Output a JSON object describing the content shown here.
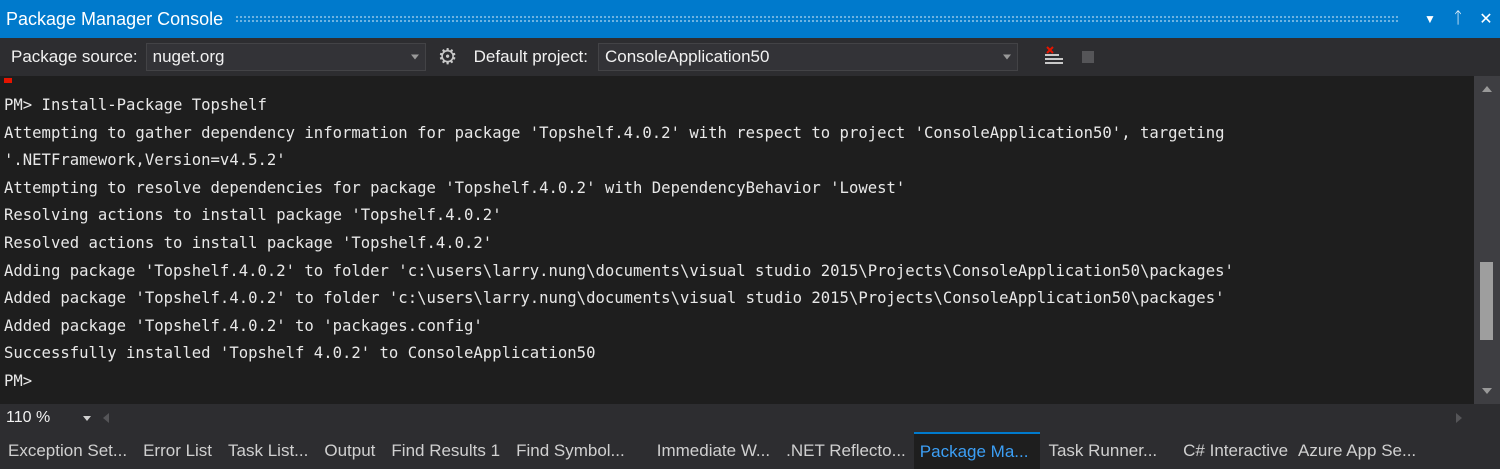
{
  "window": {
    "title": "Package Manager Console",
    "dropdown_glyph": "▼",
    "pin_glyph": "ᛏ",
    "close_glyph": "✕"
  },
  "toolbar": {
    "package_source_label": "Package source:",
    "package_source_value": "nuget.org",
    "default_project_label": "Default project:",
    "default_project_value": "ConsoleApplication50",
    "settings_icon": "gear-icon",
    "clear_icon": "clear-console-icon",
    "stop_icon": "stop-icon"
  },
  "console": {
    "lines": [
      "PM> Install-Package Topshelf",
      "Attempting to gather dependency information for package 'Topshelf.4.0.2' with respect to project 'ConsoleApplication50', targeting",
      "'.NETFramework,Version=v4.5.2'",
      "Attempting to resolve dependencies for package 'Topshelf.4.0.2' with DependencyBehavior 'Lowest'",
      "Resolving actions to install package 'Topshelf.4.0.2'",
      "Resolved actions to install package 'Topshelf.4.0.2'",
      "Adding package 'Topshelf.4.0.2' to folder 'c:\\users\\larry.nung\\documents\\visual studio 2015\\Projects\\ConsoleApplication50\\packages'",
      "Added package 'Topshelf.4.0.2' to folder 'c:\\users\\larry.nung\\documents\\visual studio 2015\\Projects\\ConsoleApplication50\\packages'",
      "Added package 'Topshelf.4.0.2' to 'packages.config'",
      "Successfully installed 'Topshelf 4.0.2' to ConsoleApplication50",
      "PM>"
    ]
  },
  "zoom": {
    "value": "110 %"
  },
  "tabs": [
    {
      "label": "Exception Set...",
      "active": false
    },
    {
      "label": "Error List",
      "active": false
    },
    {
      "label": "Task List...",
      "active": false
    },
    {
      "label": "Output",
      "active": false
    },
    {
      "label": "Find Results 1",
      "active": false
    },
    {
      "label": "Find Symbol...",
      "active": false
    },
    {
      "label": "Immediate W...",
      "active": false
    },
    {
      "label": ".NET Reflecto...",
      "active": false
    },
    {
      "label": "Package Ma...",
      "active": true
    },
    {
      "label": "Task Runner...",
      "active": false
    },
    {
      "label": "C# Interactive",
      "active": false
    },
    {
      "label": "Azure App Se...",
      "active": false
    }
  ],
  "colors": {
    "accent": "#007acc",
    "active_tab_text": "#3c9ff5",
    "console_bg": "#1e1e1e",
    "chrome_bg": "#2d2d30"
  }
}
